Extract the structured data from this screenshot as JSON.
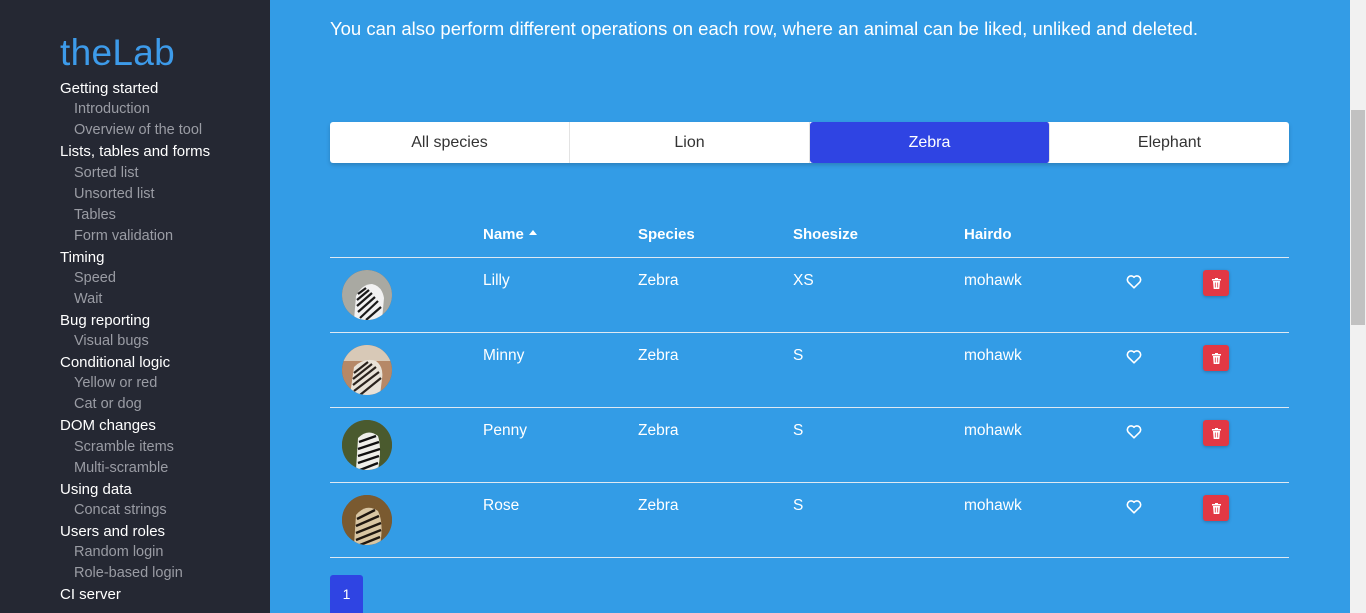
{
  "sidebar": {
    "logo": "theLab",
    "sections": [
      {
        "label": "Getting started",
        "items": [
          "Introduction",
          "Overview of the tool"
        ]
      },
      {
        "label": "Lists, tables and forms",
        "items": [
          "Sorted list",
          "Unsorted list",
          "Tables",
          "Form validation"
        ]
      },
      {
        "label": "Timing",
        "items": [
          "Speed",
          "Wait"
        ]
      },
      {
        "label": "Bug reporting",
        "items": [
          "Visual bugs"
        ]
      },
      {
        "label": "Conditional logic",
        "items": [
          "Yellow or red",
          "Cat or dog"
        ]
      },
      {
        "label": "DOM changes",
        "items": [
          "Scramble items",
          "Multi-scramble"
        ]
      },
      {
        "label": "Using data",
        "items": [
          "Concat strings"
        ]
      },
      {
        "label": "Users and roles",
        "items": [
          "Random login",
          "Role-based login"
        ]
      },
      {
        "label": "CI server",
        "items": []
      }
    ]
  },
  "main": {
    "intro": "You can also perform different operations on each row, where an animal can be liked, unliked and deleted.",
    "tabs": [
      {
        "label": "All species",
        "active": false
      },
      {
        "label": "Lion",
        "active": false
      },
      {
        "label": "Zebra",
        "active": true
      },
      {
        "label": "Elephant",
        "active": false
      }
    ],
    "table": {
      "headers": {
        "name": "Name",
        "species": "Species",
        "shoesize": "Shoesize",
        "hairdo": "Hairdo"
      },
      "sort": "name ascending",
      "rows": [
        {
          "name": "Lilly",
          "species": "Zebra",
          "shoesize": "XS",
          "hairdo": "mohawk",
          "liked": false
        },
        {
          "name": "Minny",
          "species": "Zebra",
          "shoesize": "S",
          "hairdo": "mohawk",
          "liked": false
        },
        {
          "name": "Penny",
          "species": "Zebra",
          "shoesize": "S",
          "hairdo": "mohawk",
          "liked": false
        },
        {
          "name": "Rose",
          "species": "Zebra",
          "shoesize": "S",
          "hairdo": "mohawk",
          "liked": false
        }
      ]
    },
    "pagination": {
      "current": "1"
    }
  },
  "colors": {
    "sidebar_bg": "#252833",
    "main_bg": "#339ce6",
    "accent": "#2f44e3",
    "delete": "#e23844",
    "logo": "#3d9bea"
  },
  "icons": {
    "heart": "heart-outline-icon",
    "delete": "trash-icon",
    "sort": "sort-up-icon"
  }
}
